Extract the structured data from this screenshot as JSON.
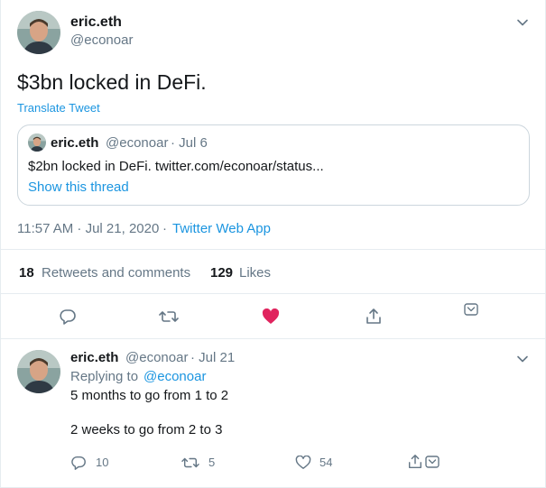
{
  "main_tweet": {
    "author_name": "eric.eth",
    "author_handle": "@econoar",
    "text": "$3bn locked in DeFi.",
    "translate_label": "Translate Tweet",
    "timestamp": "11:57 AM · Jul 21, 2020",
    "separator": "·",
    "source": "Twitter Web App"
  },
  "quoted_tweet": {
    "author_name": "eric.eth",
    "author_handle": "@econoar",
    "date": "· Jul 6",
    "text": "$2bn locked in DeFi. twitter.com/econoar/status...",
    "show_thread_label": "Show this thread"
  },
  "stats": {
    "retweets_count": "18",
    "retweets_label": "Retweets and comments",
    "likes_count": "129",
    "likes_label": "Likes"
  },
  "reply_tweet": {
    "author_name": "eric.eth",
    "author_handle": "@econoar",
    "date": "· Jul 21",
    "replying_prefix": "Replying to",
    "replying_handle": "@econoar",
    "line1": "5 months to go from 1 to 2",
    "line2": "2 weeks to go from 2 to 3",
    "reply_count": "10",
    "retweet_count": "5",
    "like_count": "54"
  },
  "colors": {
    "accent": "#1b95e0",
    "like_active": "#e0245e",
    "icon_gray": "#657786"
  },
  "icons": {
    "reply": "reply-icon",
    "retweet": "retweet-icon",
    "like": "heart-icon",
    "share": "share-icon",
    "more": "chevron-down-icon"
  }
}
